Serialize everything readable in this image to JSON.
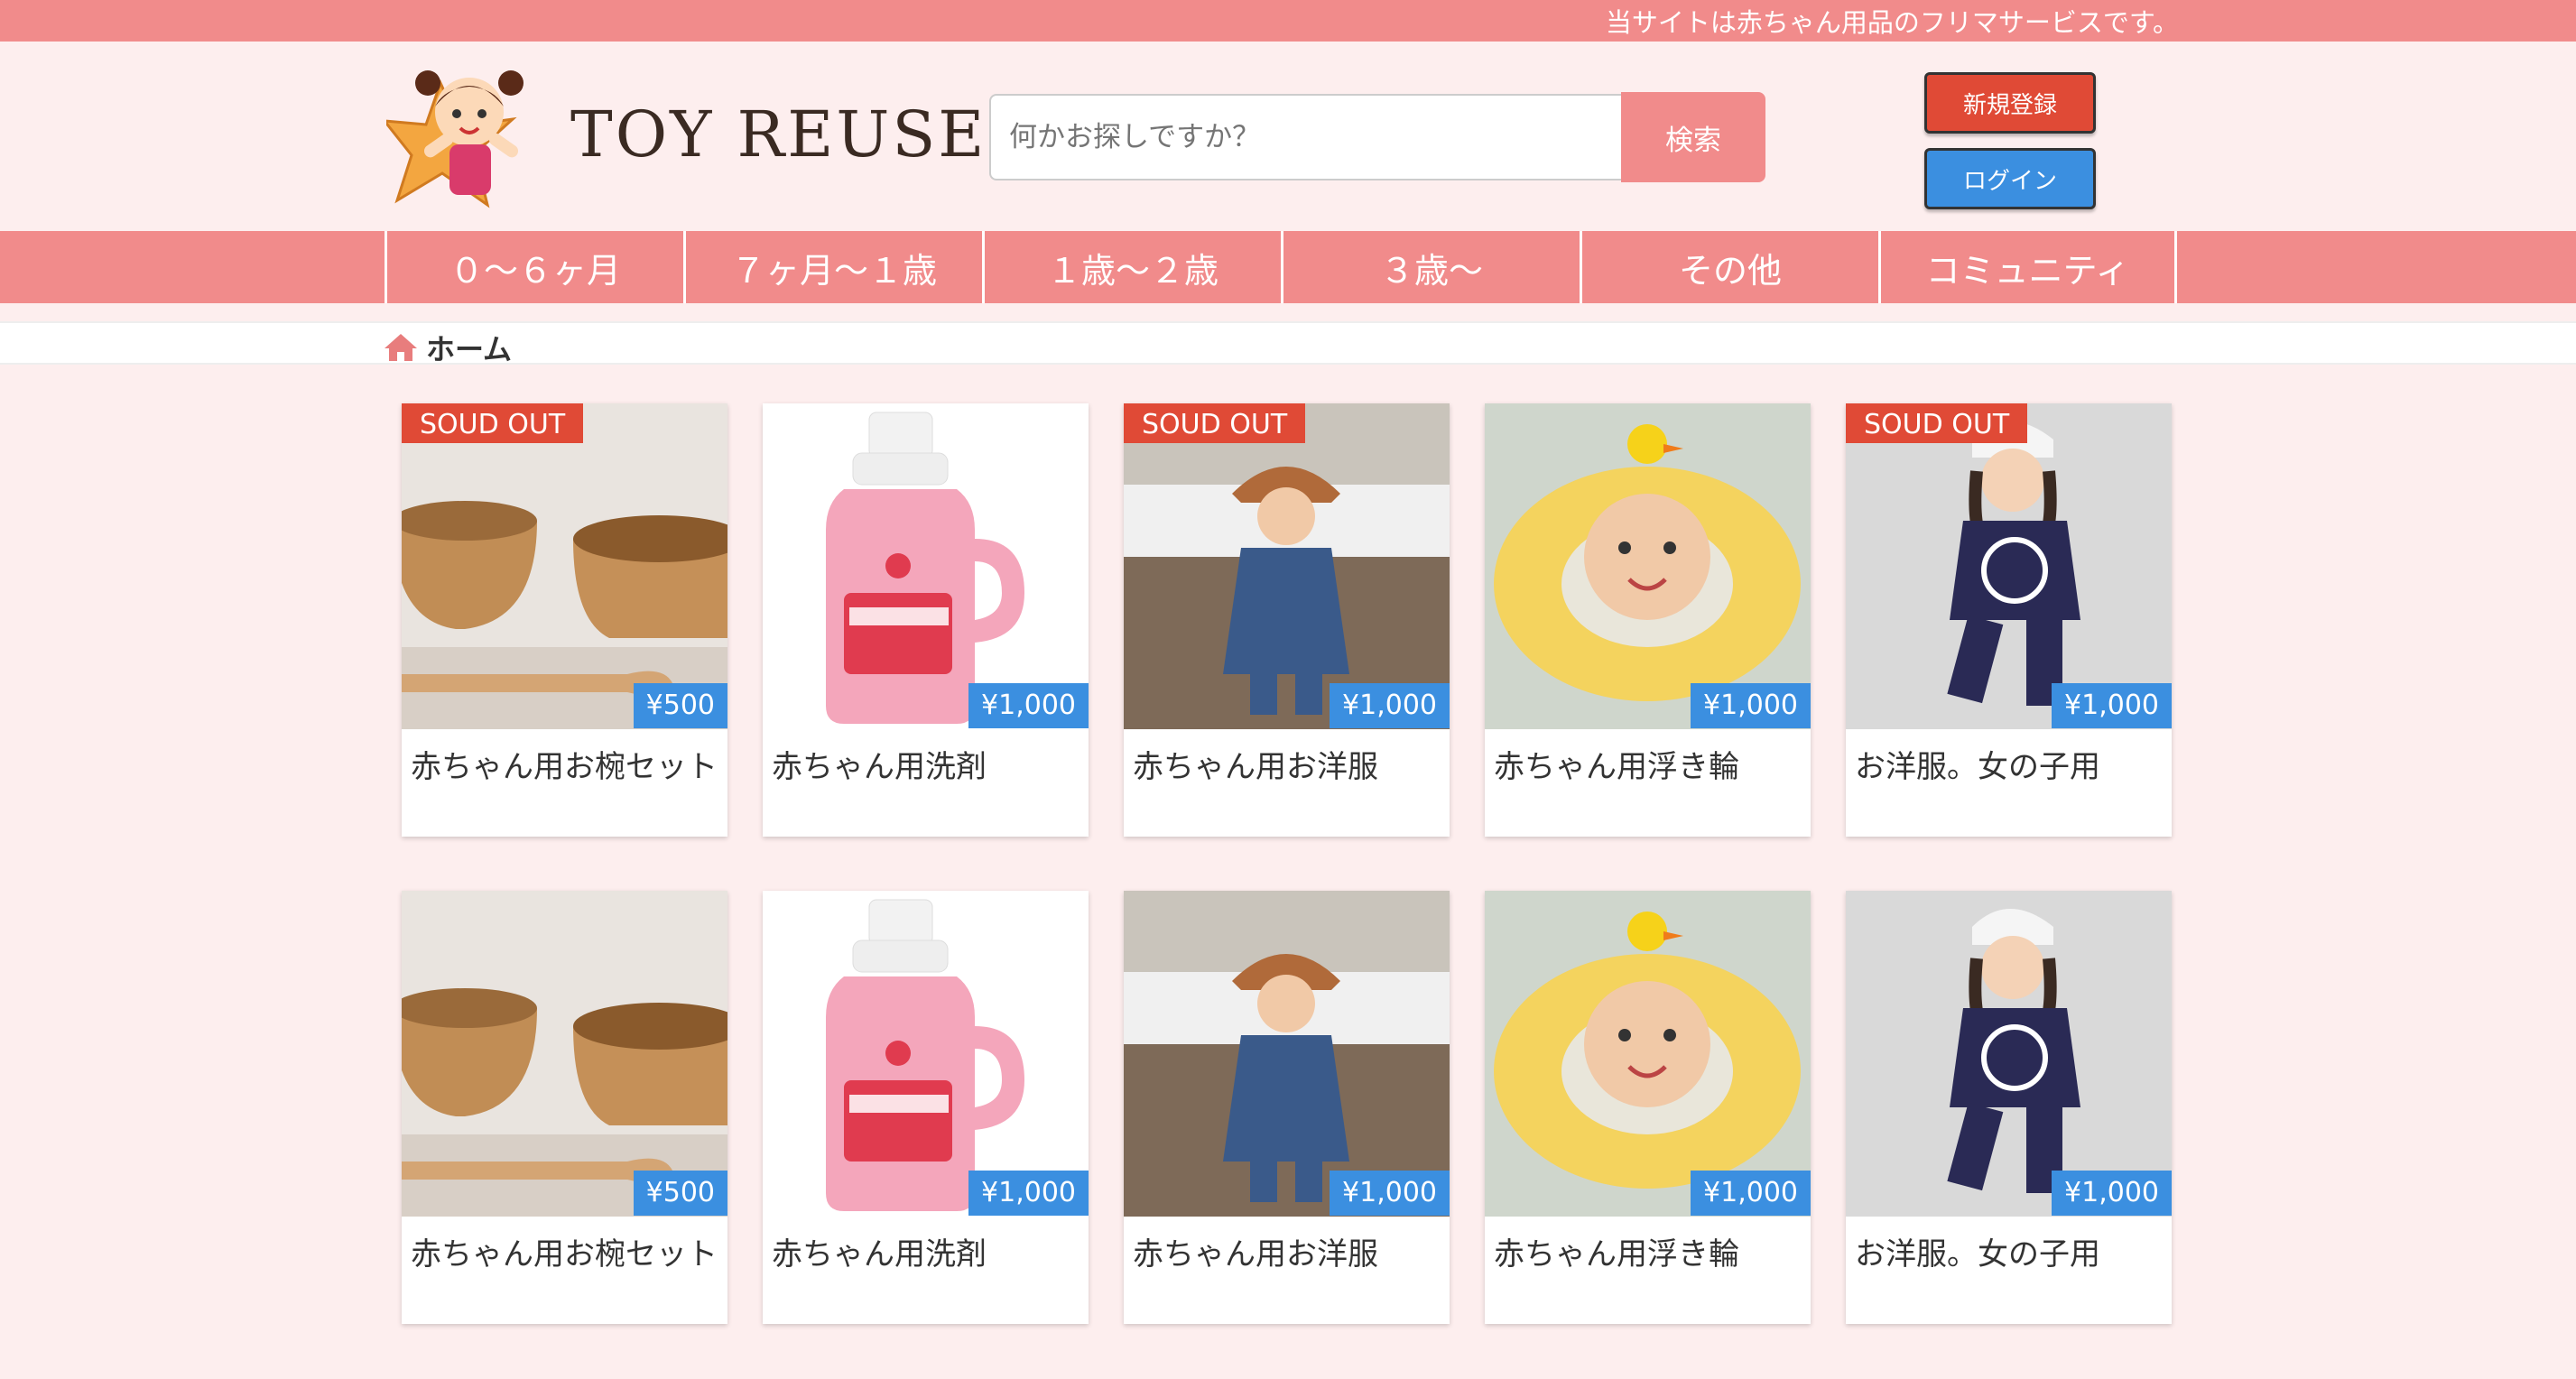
{
  "top_bar": {
    "message": "当サイトは赤ちゃん用品のフリマサービスです。"
  },
  "header": {
    "logo_text": "TOY REUSE",
    "search": {
      "placeholder": "何かお探しですか？",
      "value": "",
      "button_label": "検索"
    },
    "buttons": {
      "register": "新規登録",
      "login": "ログイン"
    }
  },
  "category_nav": {
    "items": [
      {
        "label": "０〜６ヶ月"
      },
      {
        "label": "７ヶ月〜１歳"
      },
      {
        "label": "１歳〜２歳"
      },
      {
        "label": "３歳〜"
      },
      {
        "label": "その他"
      },
      {
        "label": "コミュニティ"
      }
    ]
  },
  "breadcrumb": {
    "icon": "home-icon",
    "label": "ホーム"
  },
  "products": {
    "rows": [
      [
        {
          "name": "赤ちゃん用お椀セット",
          "price": "¥500",
          "badge": "SOUD OUT",
          "image": "wooden-bowls"
        },
        {
          "name": "赤ちゃん用洗剤",
          "price": "¥1,000",
          "badge": "",
          "image": "detergent-bottle"
        },
        {
          "name": "赤ちゃん用お洋服",
          "price": "¥1,000",
          "badge": "SOUD OUT",
          "image": "toddler-denim"
        },
        {
          "name": "赤ちゃん用浮き輪",
          "price": "¥1,000",
          "badge": "",
          "image": "baby-float-ring"
        },
        {
          "name": "お洋服。女の子用",
          "price": "¥1,000",
          "badge": "SOUD OUT",
          "image": "girl-smiley-outfit"
        }
      ],
      [
        {
          "name": "赤ちゃん用お椀セット",
          "price": "¥500",
          "badge": "",
          "image": "wooden-bowls"
        },
        {
          "name": "赤ちゃん用洗剤",
          "price": "¥1,000",
          "badge": "",
          "image": "detergent-bottle"
        },
        {
          "name": "赤ちゃん用お洋服",
          "price": "¥1,000",
          "badge": "",
          "image": "toddler-denim"
        },
        {
          "name": "赤ちゃん用浮き輪",
          "price": "¥1,000",
          "badge": "",
          "image": "baby-float-ring"
        },
        {
          "name": "お洋服。女の子用",
          "price": "¥1,000",
          "badge": "",
          "image": "girl-smiley-outfit"
        }
      ]
    ]
  },
  "colors": {
    "accent_pink": "#f18b8b",
    "page_bg": "#fdeeee",
    "sold_red": "#e04a36",
    "price_blue": "#3b8fe0"
  }
}
